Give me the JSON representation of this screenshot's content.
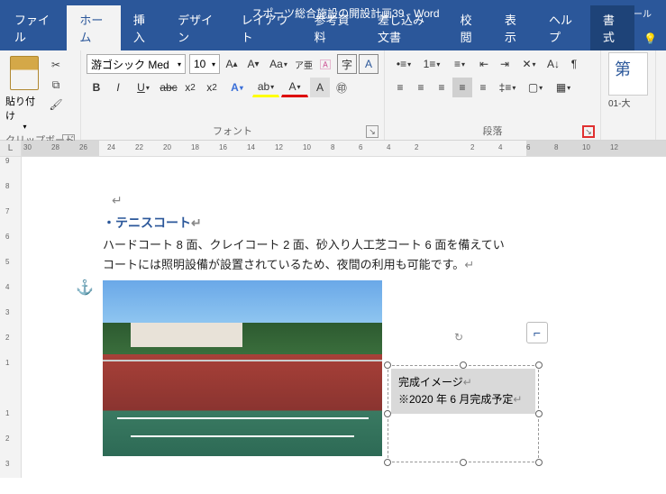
{
  "titlebar": {
    "doc_title": "スポーツ総合施設の開設計画39  -  Word",
    "tool_context_header": "描画ツール"
  },
  "tabs": {
    "file": "ファイル",
    "home": "ホーム",
    "insert": "挿入",
    "design": "デザイン",
    "layout": "レイアウト",
    "references": "参考資料",
    "mailmerge": "差し込み文書",
    "review": "校閲",
    "view": "表示",
    "help": "ヘルプ",
    "format": "書式"
  },
  "ribbon": {
    "clipboard": {
      "paste": "貼り付け",
      "group": "クリップボード"
    },
    "font": {
      "name": "游ゴシック Med",
      "size": "10",
      "group": "フォント"
    },
    "paragraph": {
      "group": "段落"
    },
    "styles": {
      "sample1": "第",
      "style1_name": "01-大"
    }
  },
  "ruler": {
    "corner": "L",
    "h_ticks": [
      "30",
      "28",
      "26",
      "24",
      "22",
      "20",
      "18",
      "16",
      "14",
      "12",
      "10",
      "8",
      "6",
      "4",
      "2",
      "",
      "2",
      "4",
      "6",
      "8",
      "10",
      "12"
    ],
    "v_ticks": [
      "9",
      "8",
      "7",
      "6",
      "5",
      "4",
      "3",
      "2",
      "1",
      "",
      "1",
      "2",
      "3"
    ]
  },
  "document": {
    "heading": "・テニスコート",
    "body_line1": "ハードコート 8 面、クレイコート 2 面、砂入り人工芝コート 6 面を備えてい",
    "body_line2": "コートには照明設備が設置されているため、夜間の利用も可能です。",
    "textbox_line1": "完成イメージ",
    "textbox_line2": "※2020 年 6 月完成予定"
  }
}
